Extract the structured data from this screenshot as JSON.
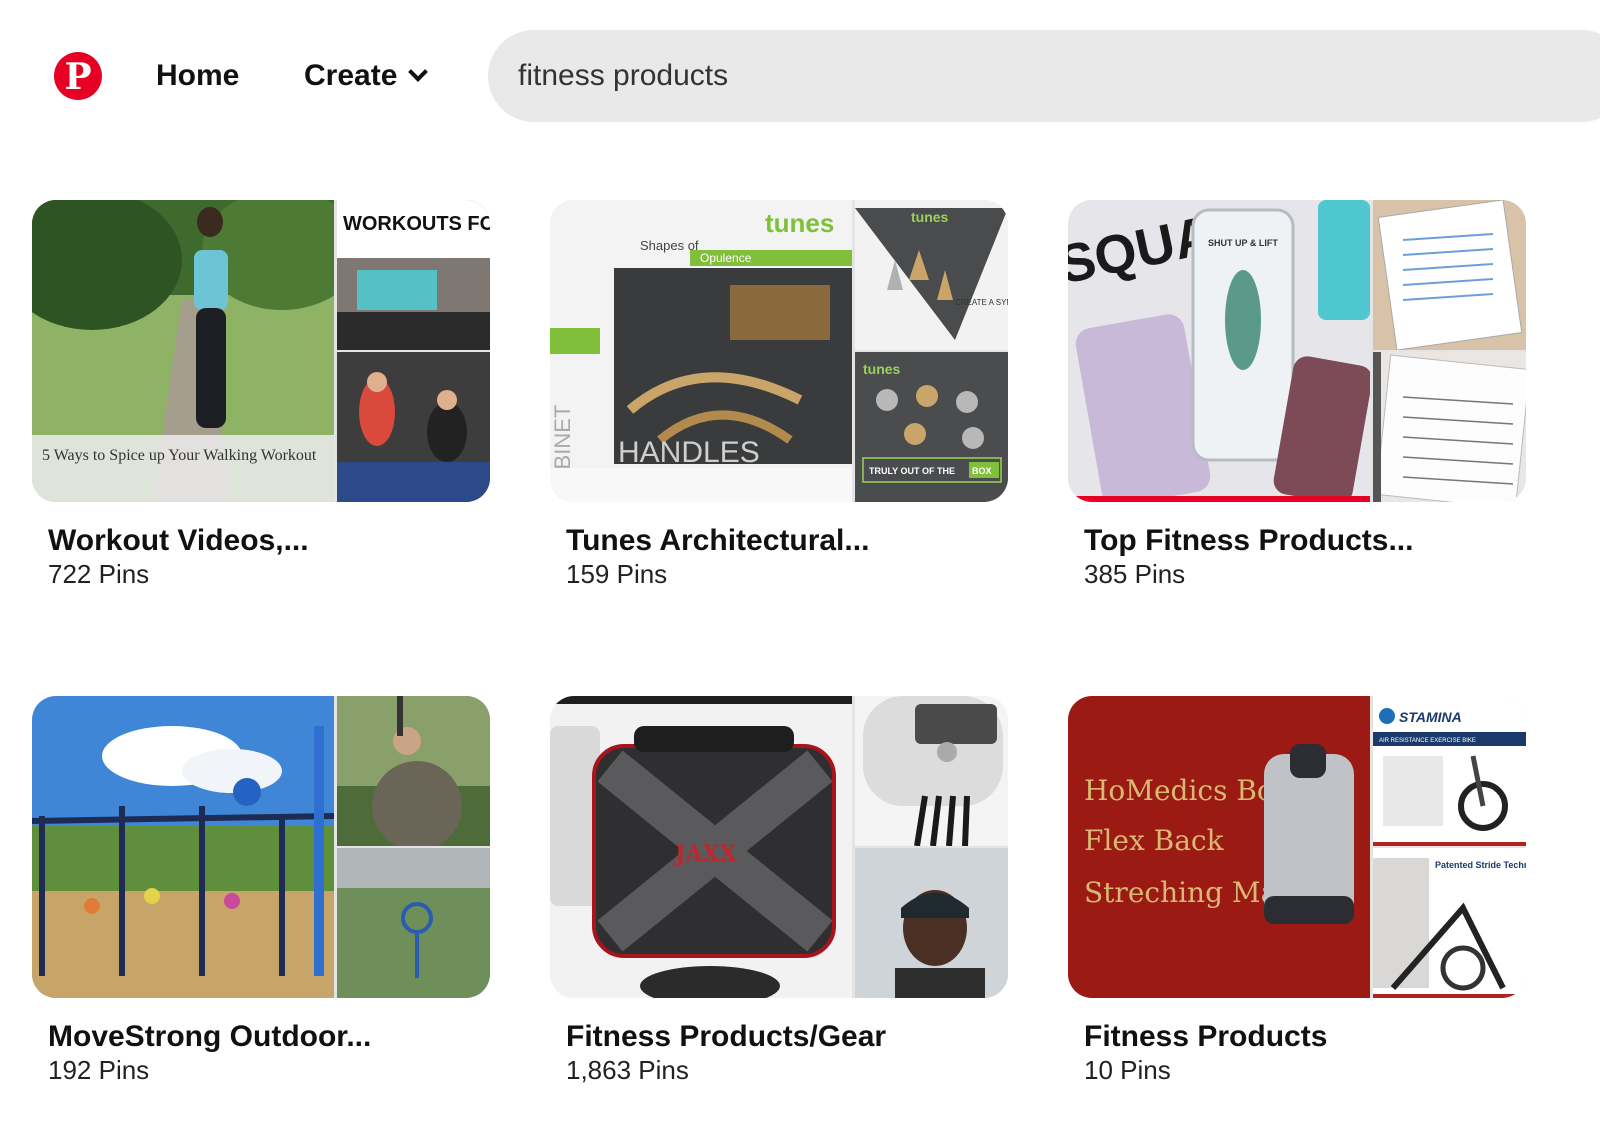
{
  "header": {
    "logo_letter": "P",
    "nav": {
      "home": "Home",
      "create": "Create"
    },
    "search": {
      "value": "fitness products"
    }
  },
  "boards": [
    {
      "title": "Workout Videos,...",
      "pins": "722 Pins",
      "cover_caption": "5 Ways to Spice up Your Walking Workout",
      "side_top_text": "WORKOUTS FOR SEXY LEGS"
    },
    {
      "title": "Tunes Architectural...",
      "pins": "159 Pins",
      "brand": "tunes",
      "subhead": "Shapes of",
      "highlight": "Opulence",
      "vertical_word": "CABINET",
      "big_word": "HANDLES",
      "tagline": "CREATE A SYMPHONY AS YOU DESIRE",
      "box_text": "TRULY OUT OF THE",
      "box_badge": "BOX"
    },
    {
      "title": "Top Fitness Products...",
      "pins": "385 Pins",
      "cover_text": "SQUAT",
      "case_text": "SHUT UP & LIFT"
    },
    {
      "title": "MoveStrong Outdoor...",
      "pins": "192 Pins"
    },
    {
      "title": "Fitness Products/Gear",
      "pins": "1,863 Pins",
      "bag_brand": "JAXX"
    },
    {
      "title": "Fitness Products",
      "pins": "10 Pins",
      "cover_line1": "HoMedics Body",
      "cover_line2": "Flex Back",
      "cover_line3": "Streching Mat",
      "side_brand": "STAMINA",
      "side_sub": "AIR RESISTANCE EXERCISE BIKE",
      "side_text": "Patented Stride Technology"
    }
  ]
}
